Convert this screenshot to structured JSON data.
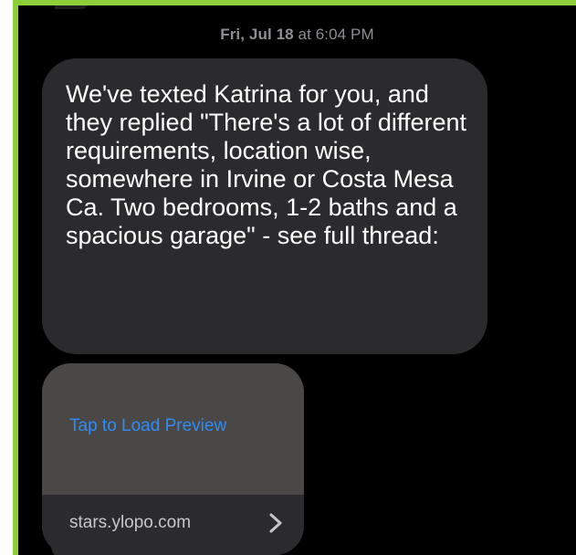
{
  "conversation": {
    "timestamp_day": "Fri, Jul 18",
    "timestamp_time": " at 6:04 PM",
    "message_text": "We've texted Katrina  for you, and they replied \"There's a lot of different requirements, location wise, somewhere in Irvine or Costa Mesa Ca. Two bedrooms, 1-2 baths and a spacious garage\" - see full thread:"
  },
  "link_preview": {
    "load_label": "Tap to Load Preview",
    "domain": "stars.ylopo.com",
    "chevron_icon": "chevron-right-icon"
  },
  "colors": {
    "background": "#000000",
    "bubble": "#2b2b2d",
    "link_blue": "#2f8cf5",
    "timestamp_gray": "#8e8e93",
    "frame_green": "#8ccf3a"
  }
}
